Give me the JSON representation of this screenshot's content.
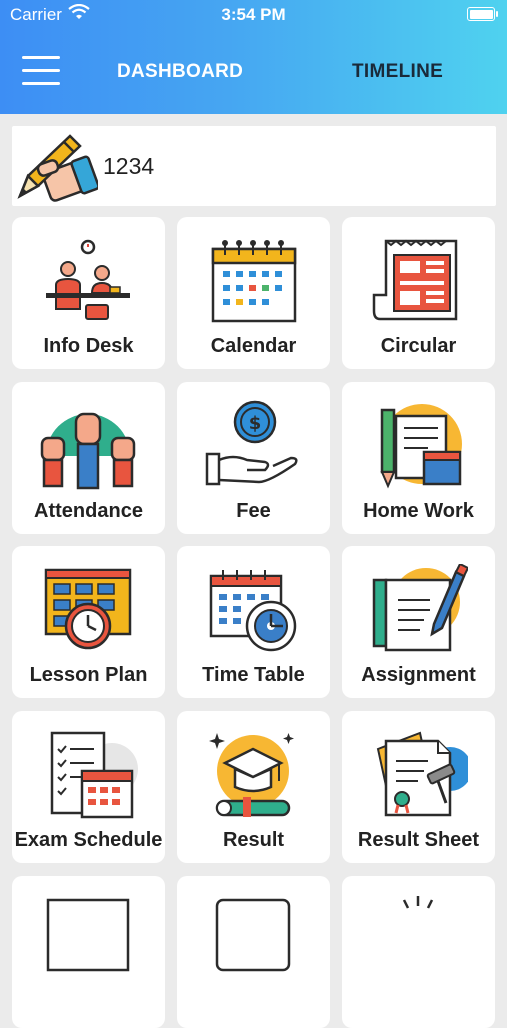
{
  "status_bar": {
    "carrier": "Carrier",
    "time": "3:54 PM"
  },
  "header": {
    "tab_dashboard": "DASHBOARD",
    "tab_timeline": "TIMELINE"
  },
  "profile": {
    "id": "1234",
    "icon": "pen-hand-icon"
  },
  "tiles": [
    {
      "label": "Info Desk",
      "icon": "info-desk-icon"
    },
    {
      "label": "Calendar",
      "icon": "calendar-icon"
    },
    {
      "label": "Circular",
      "icon": "circular-icon"
    },
    {
      "label": "Attendance",
      "icon": "attendance-icon"
    },
    {
      "label": "Fee",
      "icon": "fee-icon"
    },
    {
      "label": "Home Work",
      "icon": "home-work-icon"
    },
    {
      "label": "Lesson Plan",
      "icon": "lesson-plan-icon"
    },
    {
      "label": "Time Table",
      "icon": "time-table-icon"
    },
    {
      "label": "Assignment",
      "icon": "assignment-icon"
    },
    {
      "label": "Exam Schedule",
      "icon": "exam-schedule-icon"
    },
    {
      "label": "Result",
      "icon": "result-icon"
    },
    {
      "label": "Result Sheet",
      "icon": "result-sheet-icon"
    }
  ]
}
